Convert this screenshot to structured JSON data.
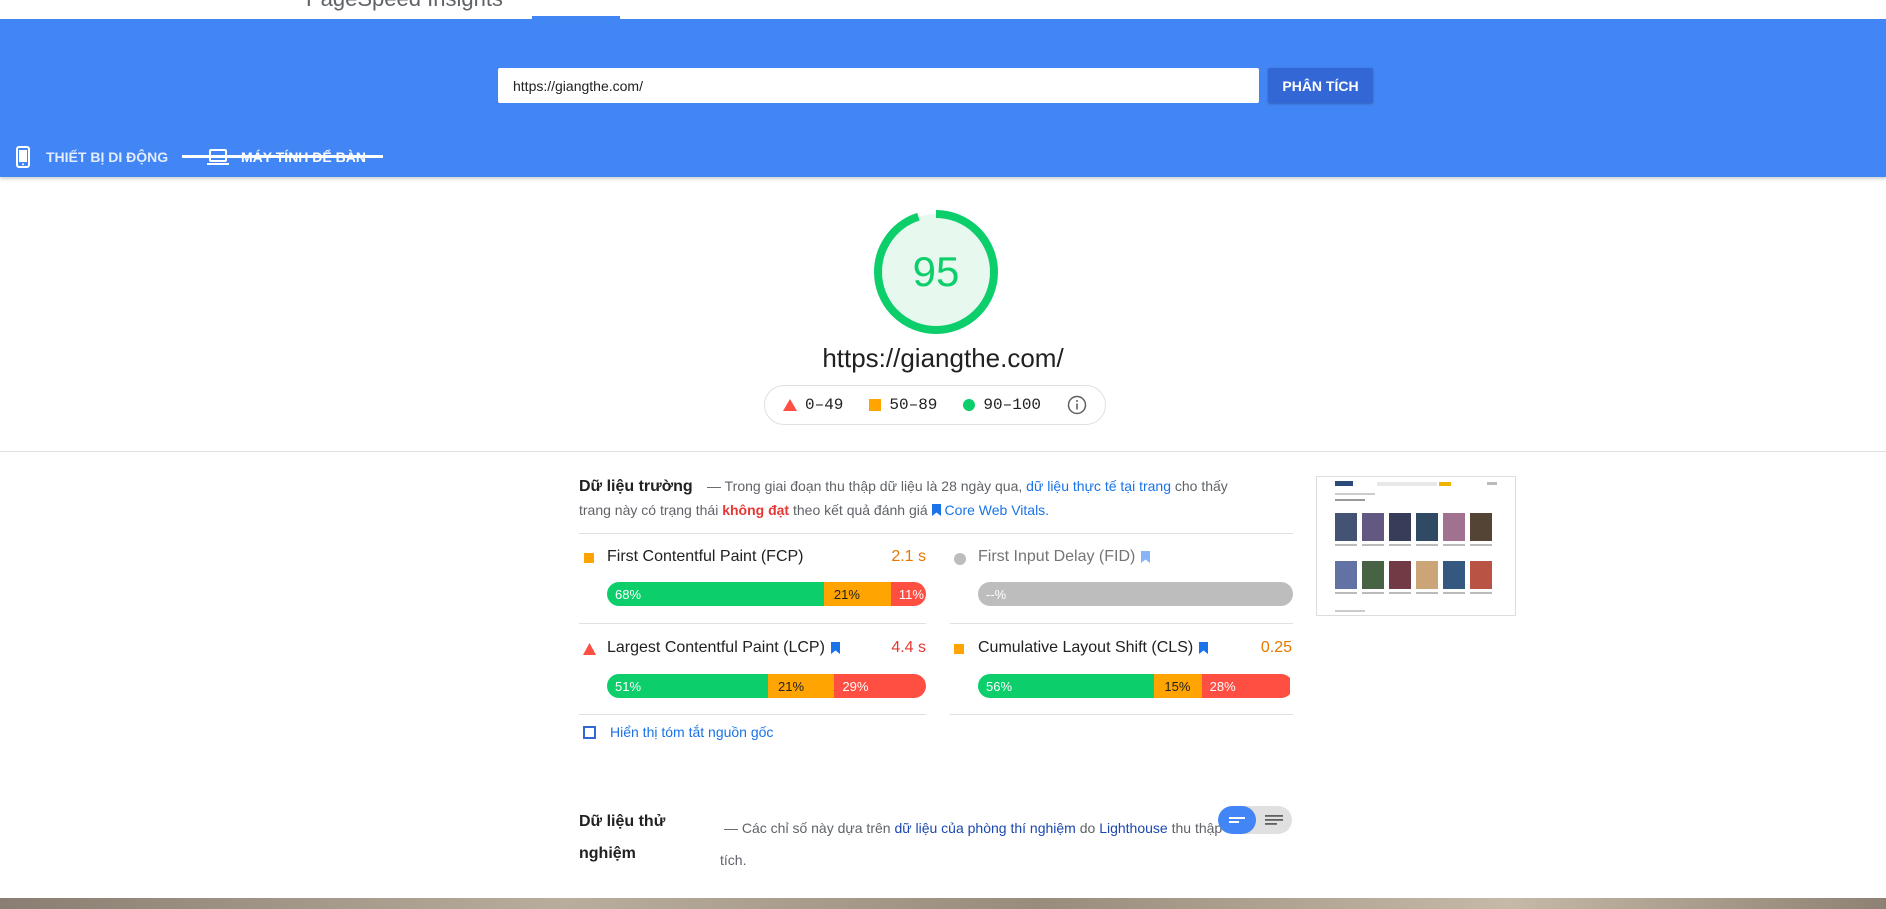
{
  "header": {
    "brand": "PageSpeed Insights"
  },
  "search": {
    "url_value": "https://giangthe.com/",
    "analyze_label": "PHÂN TÍCH"
  },
  "device_tabs": [
    {
      "label": "THIẾT BỊ DI ĐỘNG",
      "icon": "phone-icon",
      "selected": false
    },
    {
      "label": "MÁY TÍNH ĐỂ BÀN",
      "icon": "laptop-icon",
      "selected": true
    }
  ],
  "score": {
    "value": "95",
    "value_fraction": 0.95,
    "color": "#0cce6b",
    "url": "https://giangthe.com/"
  },
  "legend": [
    {
      "label": "0–49",
      "shape": "triangle",
      "color": "#ff4e42"
    },
    {
      "label": "50–89",
      "shape": "square",
      "color": "#ffa400"
    },
    {
      "label": "90–100",
      "shape": "circle",
      "color": "#0cce6b"
    }
  ],
  "field_data": {
    "title": "Dữ liệu trường",
    "desc_1": "— Trong giai đoạn thu thập dữ liệu là 28 ngày qua,",
    "desc_link": "dữ liệu thực tế tại trang",
    "desc_2": "cho thấy",
    "desc_3": "trang này có trạng thái",
    "desc_fail": "không đạt",
    "desc_4": "theo kết quả đánh giá",
    "desc_cwv": "Core Web Vitals.",
    "metrics": {
      "fcp": {
        "name": "First Contentful Paint (FCP)",
        "value": "2.1 s",
        "status": "average",
        "good": "68%",
        "avg": "21%",
        "poor": "11%",
        "good_pct": 68,
        "avg_pct": 21,
        "poor_pct": 11
      },
      "fid": {
        "name": "First Input Delay (FID)",
        "value": "",
        "bar_label": "--%"
      },
      "lcp": {
        "name": "Largest Contentful Paint (LCP)",
        "value": "4.4 s",
        "status": "poor",
        "good": "51%",
        "avg": "21%",
        "poor": "29%",
        "good_pct": 51,
        "avg_pct": 21,
        "poor_pct": 29
      },
      "cls": {
        "name": "Cumulative Layout Shift (CLS)",
        "value": "0.25",
        "status": "average",
        "good": "56%",
        "avg": "15%",
        "poor": "28%",
        "good_pct": 56,
        "avg_pct": 15,
        "poor_pct": 28
      }
    },
    "origin_summary_label": "Hiển thị tóm tắt nguồn gốc"
  },
  "lab_data": {
    "title_line1": "Dữ liệu thử",
    "title_line2": "nghiệm",
    "desc_1": "— Các chỉ số này dựa trên",
    "desc_link": "dữ liệu của phòng thí nghiệm",
    "desc_2": "do",
    "desc_lighthouse": "Lighthouse",
    "desc_3": "thu thập",
    "desc_4": "tích."
  },
  "colors": {
    "accent": "#4285f4",
    "good": "#0cce6b",
    "average": "#ffa400",
    "poor": "#ff4e42",
    "link": "#1a73e8"
  }
}
